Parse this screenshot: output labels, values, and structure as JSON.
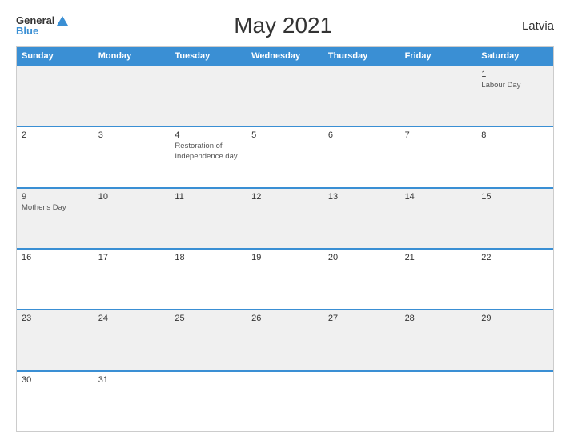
{
  "header": {
    "logo_general": "General",
    "logo_blue": "Blue",
    "title": "May 2021",
    "country": "Latvia"
  },
  "calendar": {
    "days_of_week": [
      "Sunday",
      "Monday",
      "Tuesday",
      "Wednesday",
      "Thursday",
      "Friday",
      "Saturday"
    ],
    "weeks": [
      [
        {
          "day": "",
          "event": "",
          "empty": true
        },
        {
          "day": "",
          "event": "",
          "empty": true
        },
        {
          "day": "",
          "event": "",
          "empty": true
        },
        {
          "day": "",
          "event": "",
          "empty": true
        },
        {
          "day": "",
          "event": "",
          "empty": true
        },
        {
          "day": "",
          "event": "",
          "empty": true
        },
        {
          "day": "1",
          "event": "Labour Day",
          "empty": false
        }
      ],
      [
        {
          "day": "2",
          "event": "",
          "empty": false
        },
        {
          "day": "3",
          "event": "",
          "empty": false
        },
        {
          "day": "4",
          "event": "Restoration of Independence day",
          "empty": false
        },
        {
          "day": "5",
          "event": "",
          "empty": false
        },
        {
          "day": "6",
          "event": "",
          "empty": false
        },
        {
          "day": "7",
          "event": "",
          "empty": false
        },
        {
          "day": "8",
          "event": "",
          "empty": false
        }
      ],
      [
        {
          "day": "9",
          "event": "Mother's Day",
          "empty": false
        },
        {
          "day": "10",
          "event": "",
          "empty": false
        },
        {
          "day": "11",
          "event": "",
          "empty": false
        },
        {
          "day": "12",
          "event": "",
          "empty": false
        },
        {
          "day": "13",
          "event": "",
          "empty": false
        },
        {
          "day": "14",
          "event": "",
          "empty": false
        },
        {
          "day": "15",
          "event": "",
          "empty": false
        }
      ],
      [
        {
          "day": "16",
          "event": "",
          "empty": false
        },
        {
          "day": "17",
          "event": "",
          "empty": false
        },
        {
          "day": "18",
          "event": "",
          "empty": false
        },
        {
          "day": "19",
          "event": "",
          "empty": false
        },
        {
          "day": "20",
          "event": "",
          "empty": false
        },
        {
          "day": "21",
          "event": "",
          "empty": false
        },
        {
          "day": "22",
          "event": "",
          "empty": false
        }
      ],
      [
        {
          "day": "23",
          "event": "",
          "empty": false
        },
        {
          "day": "24",
          "event": "",
          "empty": false
        },
        {
          "day": "25",
          "event": "",
          "empty": false
        },
        {
          "day": "26",
          "event": "",
          "empty": false
        },
        {
          "day": "27",
          "event": "",
          "empty": false
        },
        {
          "day": "28",
          "event": "",
          "empty": false
        },
        {
          "day": "29",
          "event": "",
          "empty": false
        }
      ],
      [
        {
          "day": "30",
          "event": "",
          "empty": false
        },
        {
          "day": "31",
          "event": "",
          "empty": false
        },
        {
          "day": "",
          "event": "",
          "empty": true
        },
        {
          "day": "",
          "event": "",
          "empty": true
        },
        {
          "day": "",
          "event": "",
          "empty": true
        },
        {
          "day": "",
          "event": "",
          "empty": true
        },
        {
          "day": "",
          "event": "",
          "empty": true
        }
      ]
    ]
  }
}
